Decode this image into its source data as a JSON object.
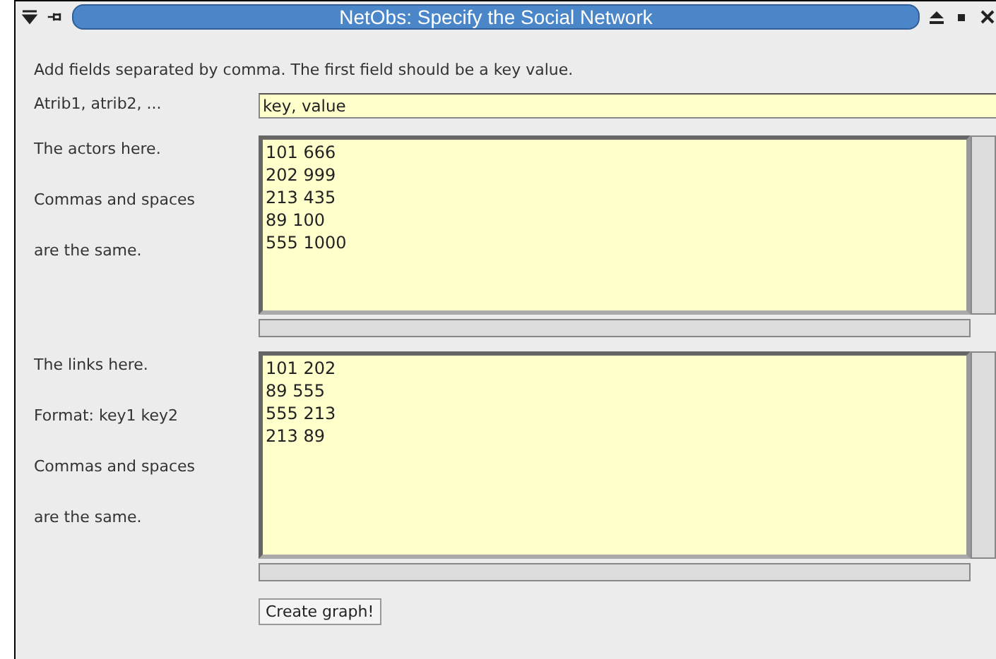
{
  "window": {
    "title": "NetObs: Specify the Social Network"
  },
  "instructions": "Add fields separated by comma. The first field should be a key value.",
  "attributes": {
    "label": "Atrib1, atrib2, ...",
    "value": "key, value"
  },
  "actors": {
    "labels": [
      "The actors here.",
      "Commas and spaces",
      "are the same."
    ],
    "lines": [
      "101 666",
      "202 999",
      "213 435",
      "89 100",
      "555 1000"
    ]
  },
  "links": {
    "labels": [
      "The links here.",
      "Format: key1 key2",
      "Commas and spaces",
      "are the same."
    ],
    "lines": [
      "101 202",
      "89 555",
      "555 213",
      "213 89"
    ]
  },
  "buttons": [
    "Create graph!"
  ]
}
